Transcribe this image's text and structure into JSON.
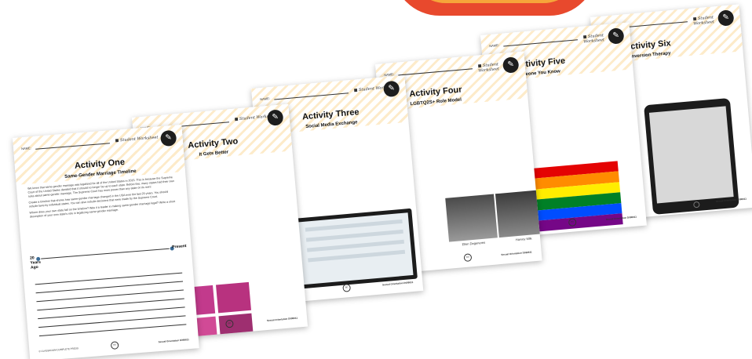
{
  "common": {
    "name_label": "NAME:",
    "student_worksheet": "Student Worksheet",
    "footer_right": "Sexual Orientation D098611",
    "page_badge": "BD"
  },
  "p1": {
    "title": "Activity One",
    "subtitle": "Same-Gender Marriage Timeline",
    "para1": "We know that same-gender marriage was legalized for all of the United States in 2015. This is because the Supreme Court of the United States decided that it should no longer be up to each state. Before this, many states had their own rules about same-gender marriage. The Supreme Court has more power than any state on its own!",
    "para2": "Create a timeline that shows how same-gender marriage changed in the USA over the last 20 years. You should include laws by individual states. You can also include decisions that were made by the Supreme Court.",
    "para3": "Where does your own state fall on the timeline? Was it a leader in making same-gender marriage legal? Write a short description of your own state's role in legalizing same-gender marriage.",
    "timeline_left": "20 Years Ago",
    "timeline_right": "Present",
    "footer_left": "© CLASSROOM COMPLETE PRESS"
  },
  "p2": {
    "title": "Activity Two",
    "subtitle": "It Gets Better"
  },
  "p3": {
    "title": "Activity Three",
    "subtitle": "Social Media Exchange"
  },
  "p4": {
    "title": "Activity Four",
    "subtitle": "LGBTQ2S+ Role Model",
    "cap1": "Ellen Degeneres",
    "cap2": "Harvey Milk"
  },
  "p5": {
    "title": "Activity Five",
    "subtitle": "Someone You Know",
    "flag_caption": "(Source: Wikipedia)"
  },
  "p6": {
    "title": "Activity Six",
    "subtitle": "Conversion Therapy"
  },
  "colors": {
    "accent_red": "#e8492d",
    "accent_orange": "#f6a53a",
    "timeline_dot": "#3a6b96",
    "logo_purple": "#7f3587",
    "flag": [
      "#e40303",
      "#ff8c00",
      "#ffed00",
      "#008026",
      "#004dff",
      "#750787"
    ]
  }
}
